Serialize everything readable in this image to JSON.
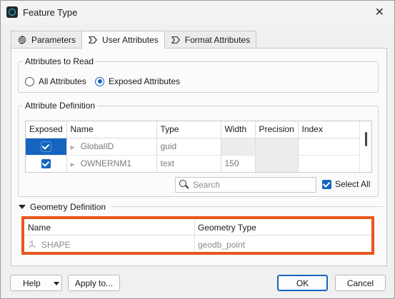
{
  "window": {
    "title": "Feature Type",
    "close_label": "✕"
  },
  "tabs": [
    {
      "label": "Parameters",
      "icon": "gear-icon",
      "active": false
    },
    {
      "label": "User Attributes",
      "icon": "chevron-tag-icon",
      "active": true
    },
    {
      "label": "Format Attributes",
      "icon": "chevron-tag-icon",
      "active": false
    }
  ],
  "attributes_to_read": {
    "label": "Attributes to Read",
    "options": [
      "All Attributes",
      "Exposed Attributes"
    ],
    "selected": "Exposed Attributes"
  },
  "attribute_definition": {
    "label": "Attribute Definition",
    "columns": [
      "Exposed",
      "Name",
      "Type",
      "Width",
      "Precision",
      "Index"
    ],
    "rows": [
      {
        "exposed": true,
        "name": "GlobalID",
        "type": "guid",
        "width": "",
        "precision": "",
        "index": ""
      },
      {
        "exposed": true,
        "name": "OWNERNM1",
        "type": "text",
        "width": "150",
        "precision": "",
        "index": ""
      }
    ],
    "search_placeholder": "Search",
    "select_all_label": "Select All",
    "select_all_checked": true
  },
  "geometry_definition": {
    "label": "Geometry Definition",
    "columns": [
      "Name",
      "Geometry Type"
    ],
    "rows": [
      {
        "name": "SHAPE",
        "geometry_type": "geodb_point"
      }
    ],
    "highlight_color": "#e8561b"
  },
  "buttons": {
    "help": "Help",
    "apply_to": "Apply to...",
    "ok": "OK",
    "cancel": "Cancel"
  },
  "colors": {
    "accent": "#1565c0"
  }
}
